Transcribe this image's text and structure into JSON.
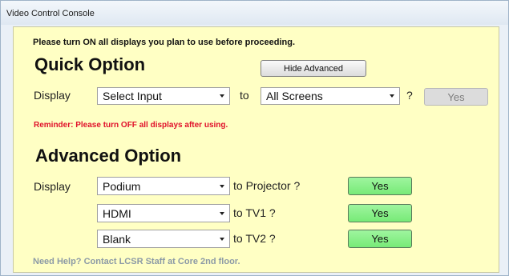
{
  "window": {
    "title": "Video Control Console"
  },
  "notice": "Please turn ON all displays you plan to use before proceeding.",
  "quick": {
    "title": "Quick Option",
    "hide_advanced_label": "Hide Advanced",
    "display_label": "Display",
    "source_value": "Select Input",
    "to_label": "to",
    "target_value": "All Screens",
    "question": "?",
    "yes_label": "Yes"
  },
  "reminder": "Reminder: Please turn OFF all displays after using.",
  "advanced": {
    "title": "Advanced Option",
    "display_label": "Display",
    "rows": [
      {
        "source": "Podium",
        "target_label": "to Projector ?",
        "yes_label": "Yes"
      },
      {
        "source": "HDMI",
        "target_label": "to TV1 ?",
        "yes_label": "Yes"
      },
      {
        "source": "Blank",
        "target_label": "to TV2 ?",
        "yes_label": "Yes"
      }
    ]
  },
  "help": "Need Help? Contact LCSR Staff at Core 2nd floor.",
  "colors": {
    "panel_background": "#ffffc4",
    "reminder_text": "#e0102a",
    "yes_active": "#77ea77",
    "yes_disabled": "#dcdcdc"
  }
}
